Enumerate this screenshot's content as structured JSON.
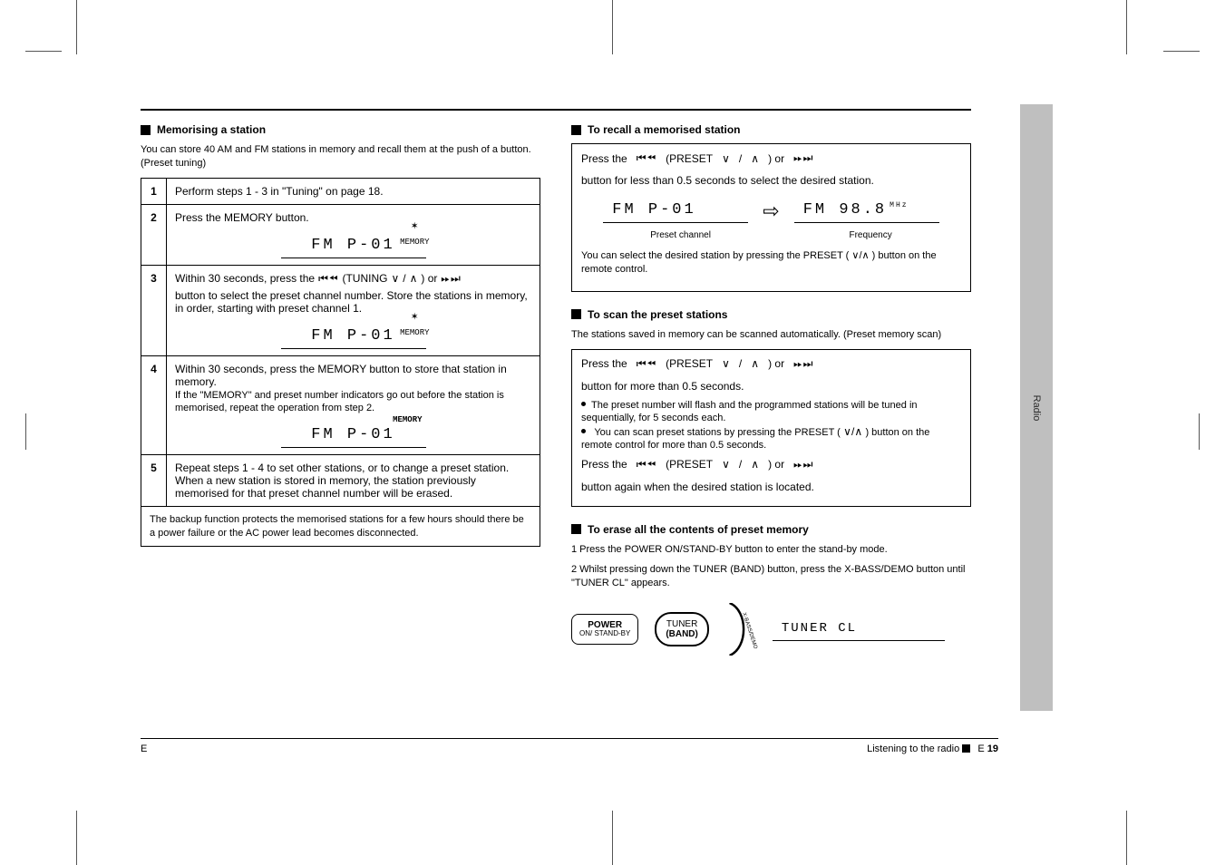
{
  "side_tab": "Radio",
  "left": {
    "heading": "Memorising a station",
    "intro": "You can store 40 AM and FM stations in memory and recall them at the push of a button. (Preset tuning)",
    "steps": [
      {
        "n": "1",
        "text": "Perform steps 1 - 3 in \"Tuning\" on page 18."
      },
      {
        "n": "2",
        "text": "Press the MEMORY button.",
        "lcd": "FM  P-01"
      },
      {
        "n": "3",
        "text_a": "Within 30 seconds, press the ",
        "text_b": "(TUNING ",
        "text_c": ") or ",
        "text_d": " button to select the preset channel number. Store the stations in memory, in order, starting with preset channel 1.",
        "lcd": "FM  P-01"
      },
      {
        "n": "4",
        "text": "Within 30 seconds, press the MEMORY button to store that station in memory.",
        "note": "If the \"MEMORY\" and preset number indicators go out before the station is memorised, repeat the operation from step 2.",
        "lcd": "FM  P-01"
      },
      {
        "n": "5",
        "text": "Repeat steps 1 - 4 to set other stations, or to change a preset station. When a new station is stored in memory, the station previously memorised for that preset channel number will be erased."
      }
    ],
    "backup": "The backup function protects the memorised stations for a few hours should there be a power failure or the AC power lead becomes disconnected."
  },
  "right": {
    "recall": {
      "heading": "To recall a memorised station",
      "line_a": "Press the ",
      "line_b": " (PRESET ",
      "line_c": ") or ",
      "line_d": " button for less than 0.5 seconds to select the desired station.",
      "lcd_left": "FM  P-01",
      "lcd_right": "FM  98.8",
      "unit": "MHz",
      "cap_left": "Preset channel",
      "cap_right": "Frequency",
      "note_a": "You can select the desired station by pressing the PRESET (",
      "note_b": ") button on the remote control."
    },
    "scan": {
      "heading": "To scan the preset stations",
      "intro": "The stations saved in memory can be scanned automatically. (Preset memory scan)",
      "line_a": "Press the ",
      "line_b": " (PRESET ",
      "line_c": ") or ",
      "line_d": " button for more than 0.5 seconds.",
      "bullet1": "The preset number will flash and the programmed stations will be tuned in sequentially, for 5 seconds each.",
      "bullet2a": "You can scan preset stations by pressing the PRESET (",
      "bullet2b": ") button on the remote control for more than 0.5 seconds.",
      "again_a": "Press the ",
      "again_b": " (PRESET ",
      "again_c": ") or ",
      "again_d": " button again when the desired station is located."
    },
    "erase": {
      "heading": "To erase all the contents of preset memory",
      "step1": "1  Press the POWER ON/STAND-BY button to enter the stand-by mode.",
      "step2": "2  Whilst pressing down the TUNER (BAND) button, press the X-BASS/DEMO button until \"TUNER CL\" appears.",
      "btn_power": {
        "top": "POWER",
        "sub": "ON/\nSTAND-BY"
      },
      "btn_tuner": {
        "top": "TUNER",
        "sub": "(BAND)"
      },
      "btn_demo": "X-BASS/DEMO",
      "lcd": "TUNER CL"
    }
  },
  "footer": {
    "left": "E",
    "right_a": "Listening to the radio ",
    "right_b": " E ",
    "page": "19"
  }
}
